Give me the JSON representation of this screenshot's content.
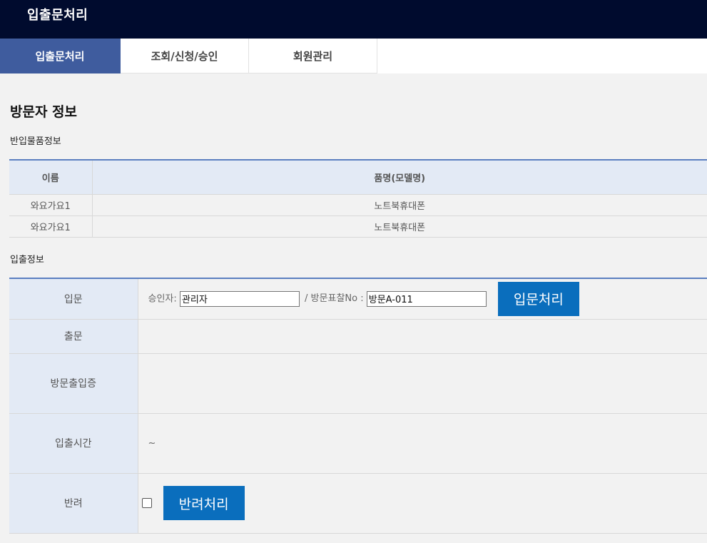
{
  "header": {
    "title": "입출문처리"
  },
  "tabs": [
    {
      "label": "입출문처리",
      "active": true
    },
    {
      "label": "조회/신청/승인",
      "active": false
    },
    {
      "label": "회원관리",
      "active": false
    }
  ],
  "visitor": {
    "section_title": "방문자 정보",
    "items_title": "반입물품정보",
    "items_headers": [
      "이름",
      "품명(모델명)"
    ],
    "items_rows": [
      [
        "와요가요1",
        "노트북휴대폰"
      ],
      [
        "와요가요1",
        "노트북휴대폰"
      ]
    ]
  },
  "access": {
    "title": "입출정보",
    "rows": {
      "entry_label": "입문",
      "exit_label": "출문",
      "pass_label": "방문출입증",
      "time_label": "입출시간",
      "reject_label": "반려"
    },
    "approver_label": "승인자:",
    "approver_value": "관리자",
    "badge_label": "/ 방문표찰No :",
    "badge_value": "방문A-011",
    "entry_button": "입문처리",
    "time_value": "~",
    "reject_checked": false,
    "reject_button": "반려처리"
  },
  "colors": {
    "header_bg": "#000b2e",
    "active_tab": "#3f5c9e",
    "button_blue": "#0a6ebd",
    "table_header": "#e3eaf5"
  }
}
